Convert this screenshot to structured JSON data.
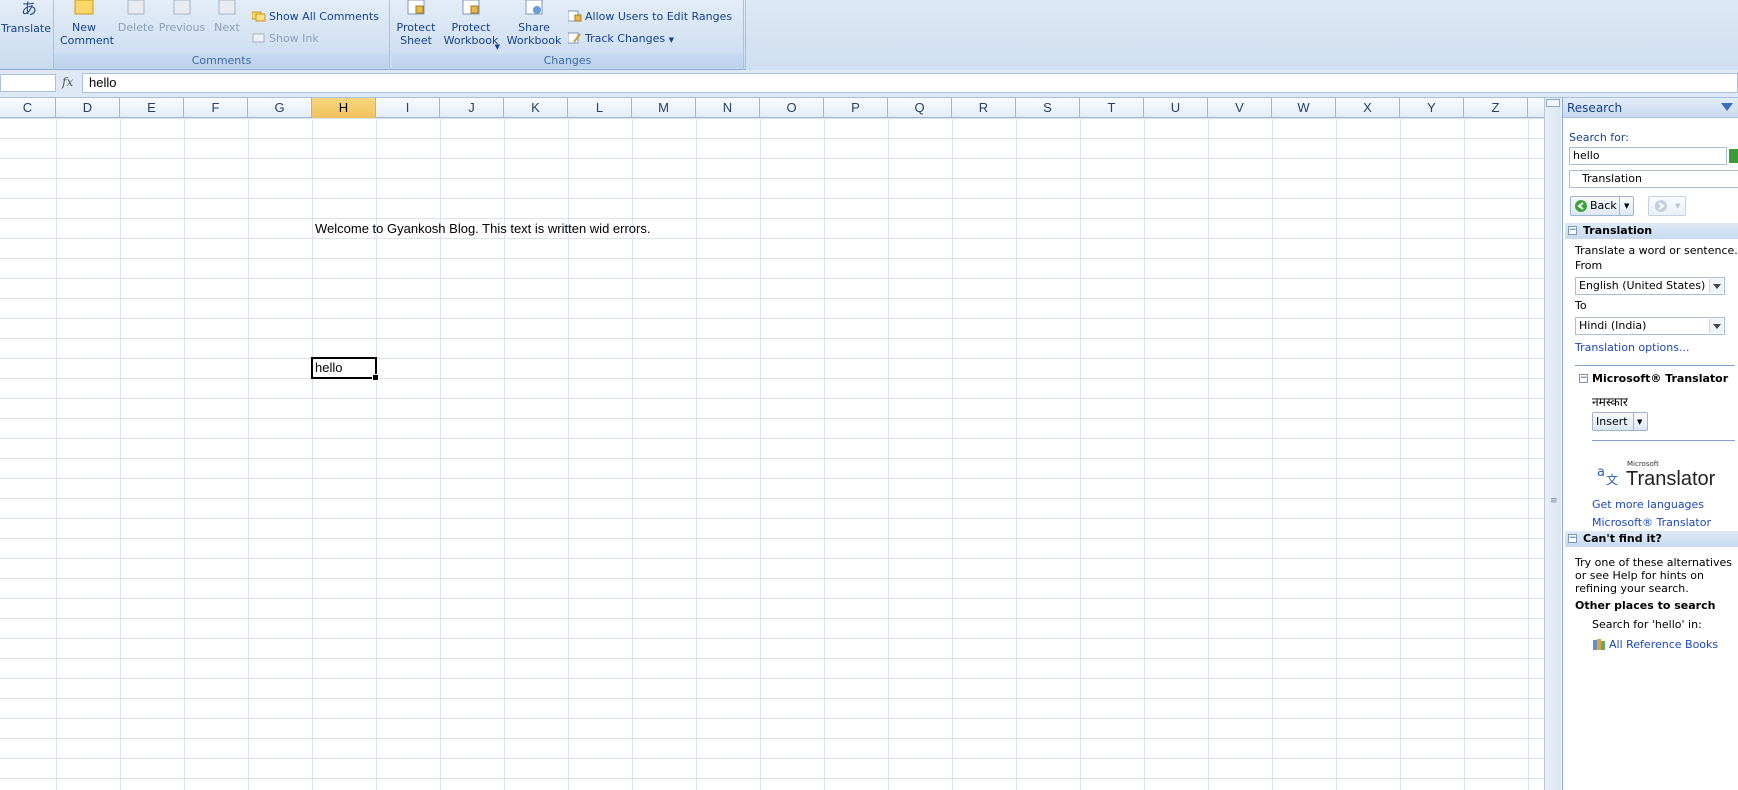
{
  "ribbon": {
    "translate_label": "Translate",
    "comments": {
      "group_label": "Comments",
      "new_comment": "New\nComment",
      "delete": "Delete",
      "previous": "Previous",
      "next": "Next",
      "show_all_comments": "Show All Comments",
      "show_ink": "Show Ink"
    },
    "changes": {
      "group_label": "Changes",
      "protect_sheet": "Protect\nSheet",
      "protect_workbook": "Protect\nWorkbook",
      "share_workbook": "Share\nWorkbook",
      "allow_users": "Allow Users to Edit Ranges",
      "track_changes": "Track Changes"
    }
  },
  "formula_bar": {
    "fx_symbol": "fx",
    "value": "hello"
  },
  "grid": {
    "columns": [
      "C",
      "D",
      "E",
      "F",
      "G",
      "H",
      "I",
      "J",
      "K",
      "L",
      "M",
      "N",
      "O",
      "P",
      "Q",
      "R",
      "S",
      "T",
      "U",
      "V",
      "W",
      "X",
      "Y",
      "Z"
    ],
    "active_column": "H",
    "welcome_text": "Welcome to Gyankosh Blog. This text is written wid errors.",
    "active_cell_value": "hello"
  },
  "research": {
    "title": "Research",
    "search_for_label": "Search for:",
    "search_value": "hello",
    "service": "Translation",
    "back_label": "Back",
    "translation_section": "Translation",
    "translate_hint": "Translate a word or sentence.",
    "from_label": "From",
    "from_value": "English (United States)",
    "to_label": "To",
    "to_value": "Hindi (India)",
    "translation_options": "Translation options...",
    "ms_translator_section": "Microsoft® Translator",
    "translated_word": "नमस्कार",
    "insert_label": "Insert",
    "logo_small": "Microsoft",
    "logo_text": "Translator",
    "get_more_languages": "Get more languages",
    "ms_translator_link": "Microsoft® Translator",
    "cant_find": "Can't find it?",
    "alternatives_text": "Try one of these alternatives or see Help for hints on refining your search.",
    "other_places": "Other places to search",
    "search_in": "Search for 'hello' in:",
    "all_reference_books": "All Reference Books"
  }
}
